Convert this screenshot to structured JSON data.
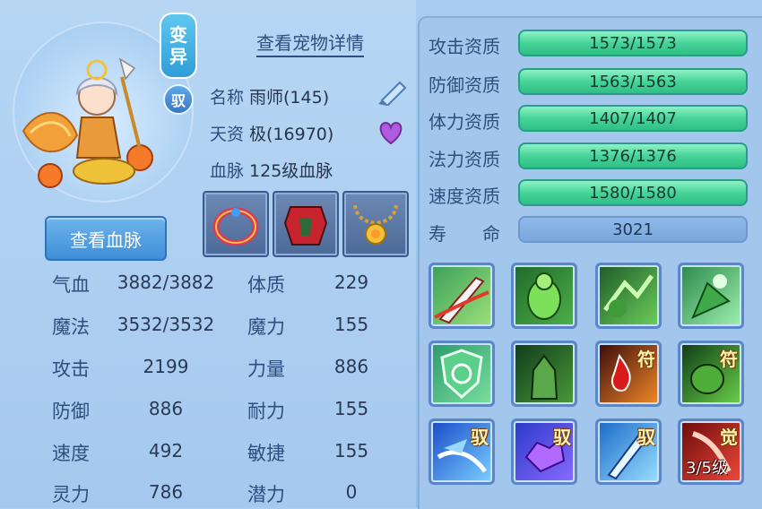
{
  "pet": {
    "variant_label": "变异",
    "variant_chars": [
      "变",
      "异"
    ],
    "yu_badge": "驭",
    "view_details_label": "查看宠物详情",
    "name_label": "名称",
    "name_value": "雨师(145)",
    "aptitude_label": "天资",
    "aptitude_value": "极(16970)",
    "bloodline_label": "血脉",
    "bloodline_value": "125级血脉",
    "view_bloodline_label": "查看血脉"
  },
  "equipment": [
    {
      "icon": "jeweled-ring-icon"
    },
    {
      "icon": "red-armor-icon"
    },
    {
      "icon": "sun-necklace-icon"
    }
  ],
  "stats_left": [
    {
      "label": "气血",
      "value": "3882/3882"
    },
    {
      "label": "魔法",
      "value": "3532/3532"
    },
    {
      "label": "攻击",
      "value": "2199"
    },
    {
      "label": "防御",
      "value": "886"
    },
    {
      "label": "速度",
      "value": "492"
    },
    {
      "label": "灵力",
      "value": "786"
    }
  ],
  "stats_right": [
    {
      "label": "体质",
      "value": "229"
    },
    {
      "label": "魔力",
      "value": "155"
    },
    {
      "label": "力量",
      "value": "886"
    },
    {
      "label": "耐力",
      "value": "155"
    },
    {
      "label": "敏捷",
      "value": "155"
    },
    {
      "label": "潜力",
      "value": "0"
    }
  ],
  "aptitudes": [
    {
      "label": "攻击资质",
      "value": "1573/1573"
    },
    {
      "label": "防御资质",
      "value": "1563/1563"
    },
    {
      "label": "体力资质",
      "value": "1407/1407"
    },
    {
      "label": "法力资质",
      "value": "1376/1376"
    },
    {
      "label": "速度资质",
      "value": "1580/1580"
    }
  ],
  "lifespan": {
    "label": "寿　　命",
    "value": "3021"
  },
  "skills": [
    {
      "icon": "sword-slash-icon",
      "badge": ""
    },
    {
      "icon": "green-demon-icon",
      "badge": ""
    },
    {
      "icon": "green-shadow-strike-icon",
      "badge": ""
    },
    {
      "icon": "green-charge-icon",
      "badge": ""
    },
    {
      "icon": "green-shield-icon",
      "badge": ""
    },
    {
      "icon": "green-giant-icon",
      "badge": ""
    },
    {
      "icon": "blood-drop-icon",
      "badge": "符"
    },
    {
      "icon": "green-beast-icon",
      "badge": "符"
    },
    {
      "icon": "blue-slash-icon",
      "badge": "驭"
    },
    {
      "icon": "purple-crystal-icon",
      "badge": "驭"
    },
    {
      "icon": "blue-blade-icon",
      "badge": "驭"
    },
    {
      "icon": "red-awaken-icon",
      "badge": "觉",
      "level": "3/5级"
    }
  ],
  "colors": {
    "aptitude_bar": "#46d498",
    "lifespan_bar": "#7aa8de",
    "text_label": "#2d4f7d"
  }
}
